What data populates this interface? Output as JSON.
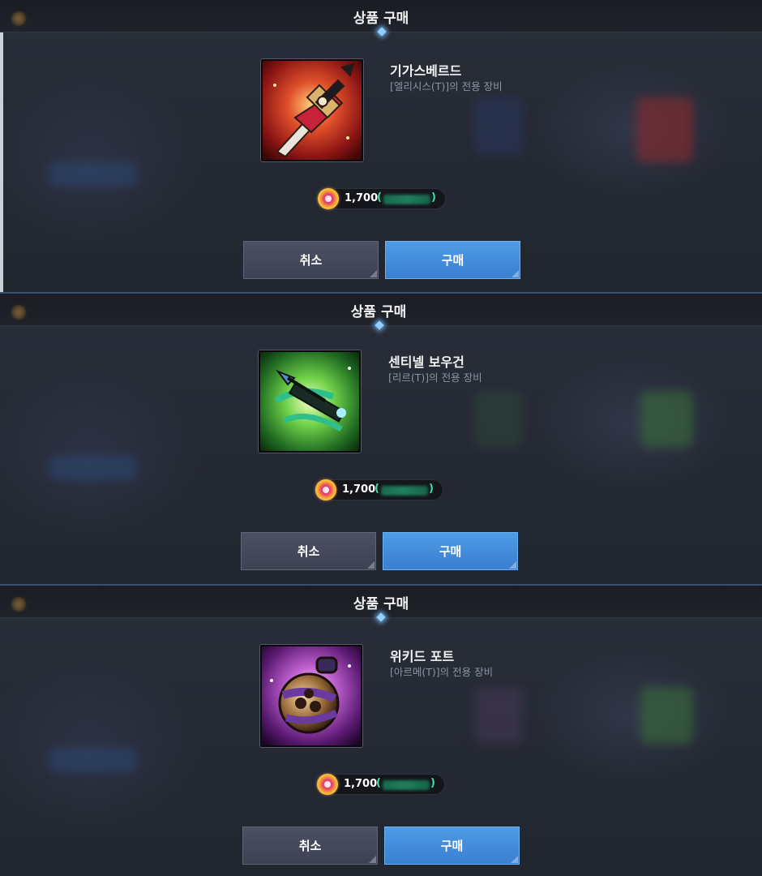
{
  "dialogs": [
    {
      "title": "상품 구매",
      "item_name": "기가스베르드",
      "item_desc": "[엘리시스(T)]의 전용 장비",
      "item_icon": "red-sword-icon",
      "price": "1,700",
      "price_paren_open": "(",
      "price_paren_close": ")",
      "cancel_label": "취소",
      "buy_label": "구매"
    },
    {
      "title": "상품 구매",
      "item_name": "센티넬 보우건",
      "item_desc": "[리르(T)]의 전용 장비",
      "item_icon": "green-crossbow-icon",
      "price": "1,700",
      "price_paren_open": "(",
      "price_paren_close": ")",
      "cancel_label": "취소",
      "buy_label": "구매"
    },
    {
      "title": "상품 구매",
      "item_name": "위키드 포트",
      "item_desc": "[아르메(T)]의 전용 장비",
      "item_icon": "purple-pot-icon",
      "price": "1,700",
      "price_paren_open": "(",
      "price_paren_close": ")",
      "cancel_label": "취소",
      "buy_label": "구매"
    }
  ],
  "colors": {
    "buy_button": "#3a7fd0",
    "cancel_button": "#434758",
    "price_paren": "#3fe0a0",
    "title_bar": "#1d2027"
  }
}
